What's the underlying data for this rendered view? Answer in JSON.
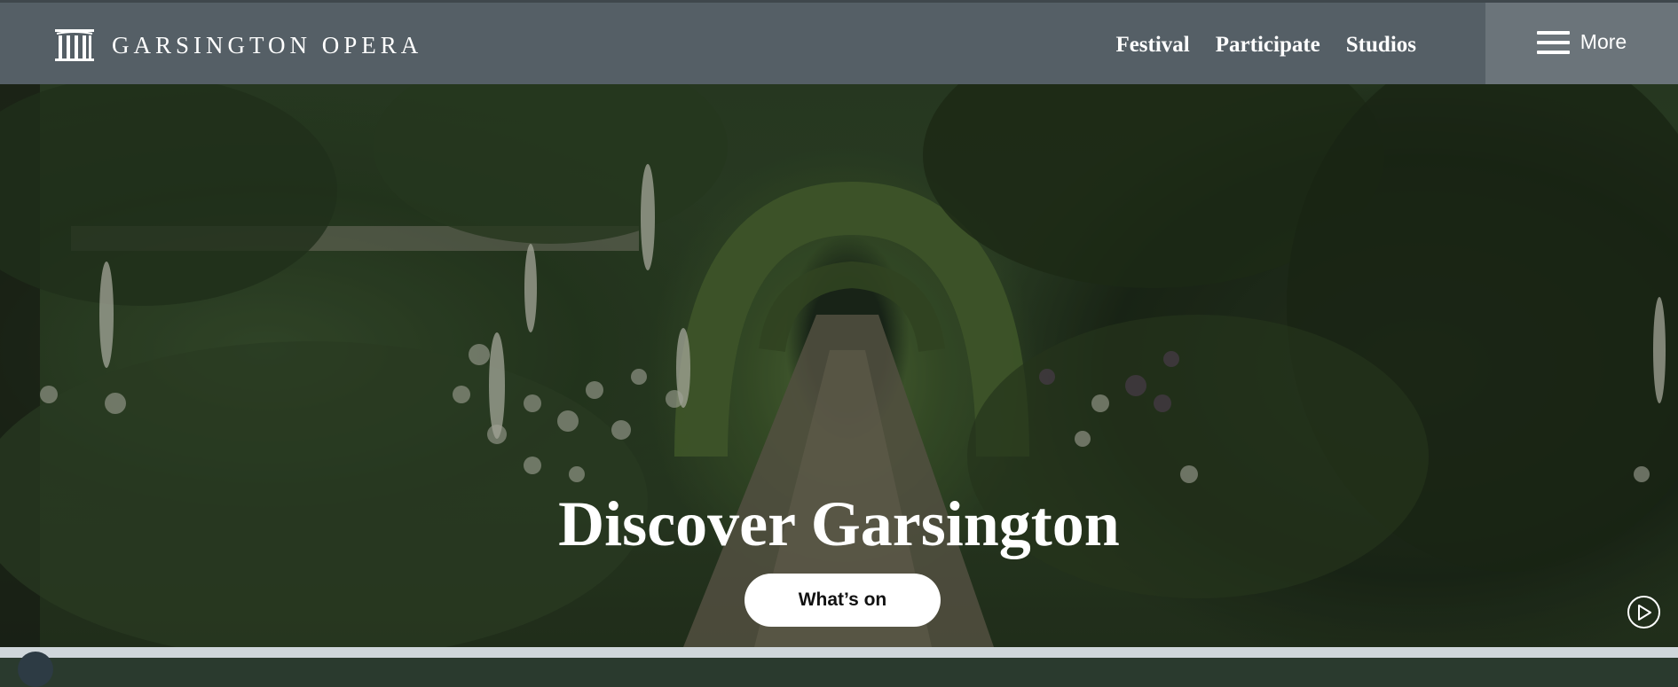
{
  "header": {
    "logo_text": "GARSINGTON OPERA",
    "nav": [
      {
        "label": "Festival"
      },
      {
        "label": "Participate"
      },
      {
        "label": "Studios"
      }
    ],
    "more_label": "More"
  },
  "hero": {
    "title": "Discover Garsington",
    "cta_label": "What’s on",
    "play_icon": "play-icon"
  },
  "colors": {
    "header_bg": "#555f66",
    "more_bg": "#6b747a",
    "cta_bg": "#ffffff"
  }
}
